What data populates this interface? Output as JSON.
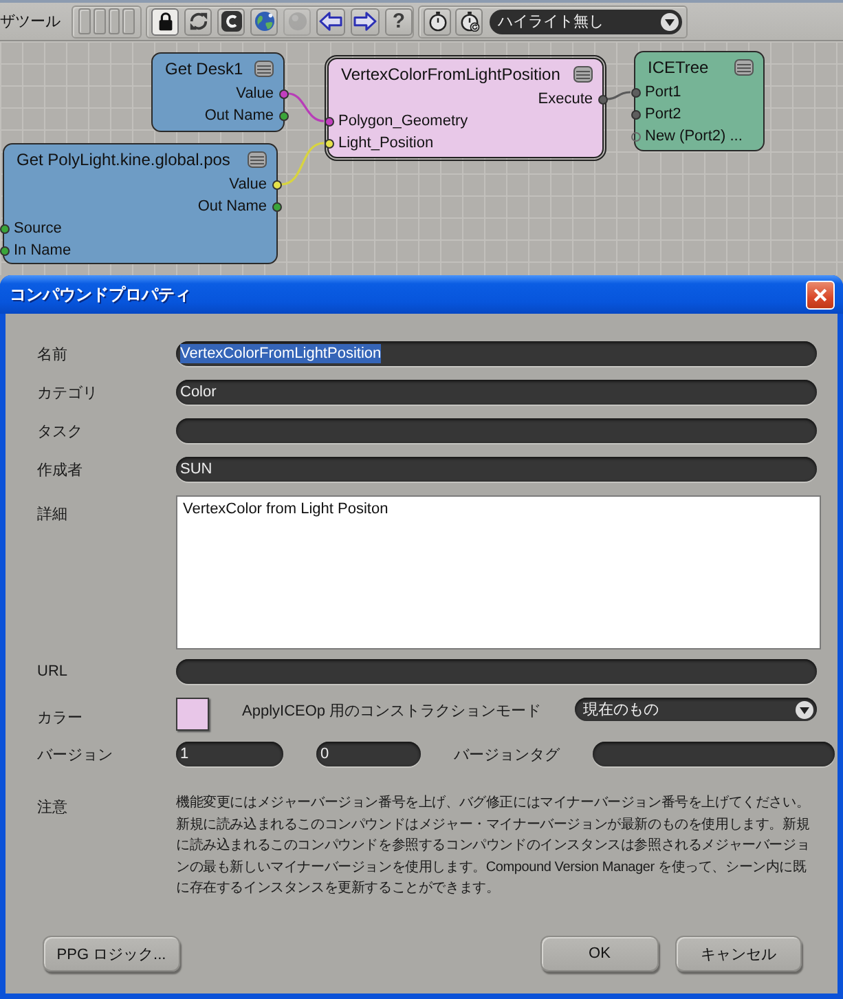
{
  "toolbar": {
    "label": "ザツール",
    "buttons": [
      {
        "kind": "lock",
        "on": true,
        "disabled": false
      },
      {
        "kind": "refresh",
        "on": false,
        "disabled": false
      },
      {
        "kind": "c",
        "on": false,
        "disabled": false
      },
      {
        "kind": "globe",
        "on": false,
        "disabled": false
      },
      {
        "kind": "sphere",
        "on": false,
        "disabled": true
      },
      {
        "kind": "back",
        "on": false,
        "disabled": false
      },
      {
        "kind": "forward",
        "on": false,
        "disabled": false
      },
      {
        "kind": "help",
        "label": "?",
        "on": false,
        "disabled": false
      }
    ],
    "timers": [
      {
        "kind": "stopwatch"
      },
      {
        "kind": "stopwatch-reset"
      }
    ],
    "highlight_menu": {
      "value": "ハイライト無し"
    }
  },
  "graph": {
    "nodes": [
      {
        "title": "Get Desk1",
        "color": "#6e9cc5",
        "selected": false,
        "outputs": [
          {
            "label": "Value",
            "color": "#c23fbf"
          },
          {
            "label": "Out Name",
            "color": "#3aa53a"
          }
        ]
      },
      {
        "title": "VertexColorFromLightPosition",
        "color": "#e8c8e8",
        "selected": true,
        "outputs": [
          {
            "label": "Execute",
            "color": "#5e5e5e"
          }
        ],
        "inputs": [
          {
            "label": "Polygon_Geometry",
            "color": "#c23fbf"
          },
          {
            "label": "Light_Position",
            "color": "#e6e24a"
          }
        ]
      },
      {
        "title": "ICETree",
        "color": "#76b496",
        "selected": false,
        "inputs": [
          {
            "label": "Port1",
            "kind": "port",
            "color": "#5e5e5e"
          },
          {
            "label": "Port2",
            "kind": "port",
            "color": "#5e5e5e"
          },
          {
            "label": "New (Port2) ...",
            "kind": "new"
          }
        ]
      },
      {
        "title": "Get PolyLight.kine.global.pos",
        "color": "#6e9cc5",
        "selected": false,
        "outputs": [
          {
            "label": "Value",
            "color": "#e6e24a"
          },
          {
            "label": "Out Name",
            "color": "#3aa53a"
          }
        ],
        "inputs": [
          {
            "label": "Source",
            "color": "#3aa53a"
          },
          {
            "label": "In Name",
            "color": "#3aa53a"
          }
        ]
      }
    ],
    "wires": [
      {
        "color": "#b83db8"
      },
      {
        "color": "#d8d440"
      },
      {
        "color": "#5a5a5a"
      }
    ]
  },
  "dialog": {
    "title": "コンパウンドプロパティ",
    "fields": [
      {
        "kind": "text",
        "label": "名前",
        "value": "VertexColorFromLightPosition",
        "highlighted": true
      },
      {
        "kind": "text",
        "label": "カテゴリ",
        "value": "Color",
        "highlighted": false
      },
      {
        "kind": "text",
        "label": "タスク"
      },
      {
        "kind": "text",
        "label": "作成者",
        "value": "SUN",
        "highlighted": false
      },
      {
        "kind": "textarea",
        "label": "詳細",
        "value": "VertexColor from Light Positon"
      },
      {
        "kind": "text",
        "label": "URL"
      },
      {
        "kind": "color",
        "label": "カラー",
        "color": "#e8c6e8",
        "mode_label": "ApplyICEOp 用のコンストラクションモード",
        "mode_value": "現在のもの"
      },
      {
        "kind": "version",
        "label": "バージョン",
        "major": "1",
        "minor": "0",
        "tag_label": "バージョンタグ"
      },
      {
        "kind": "note",
        "label": "注意",
        "text": "機能変更にはメジャーバージョン番号を上げ、バグ修正にはマイナーバージョン番号を上げてください。新規に読み込まれるこのコンパウンドはメジャー・マイナーバージョンが最新のものを使用します。新規に読み込まれるこのコンパウンドを参照するコンパウンドのインスタンスは参照されるメジャーバージョンの最も新しいマイナーバージョンを使用します。Compound Version Manager を使って、シーン内に既に存在するインスタンスを更新することができます。"
      }
    ],
    "buttons": [
      {
        "label": "PPG ロジック..."
      },
      {
        "label": "OK"
      },
      {
        "label": "キャンセル"
      }
    ]
  }
}
